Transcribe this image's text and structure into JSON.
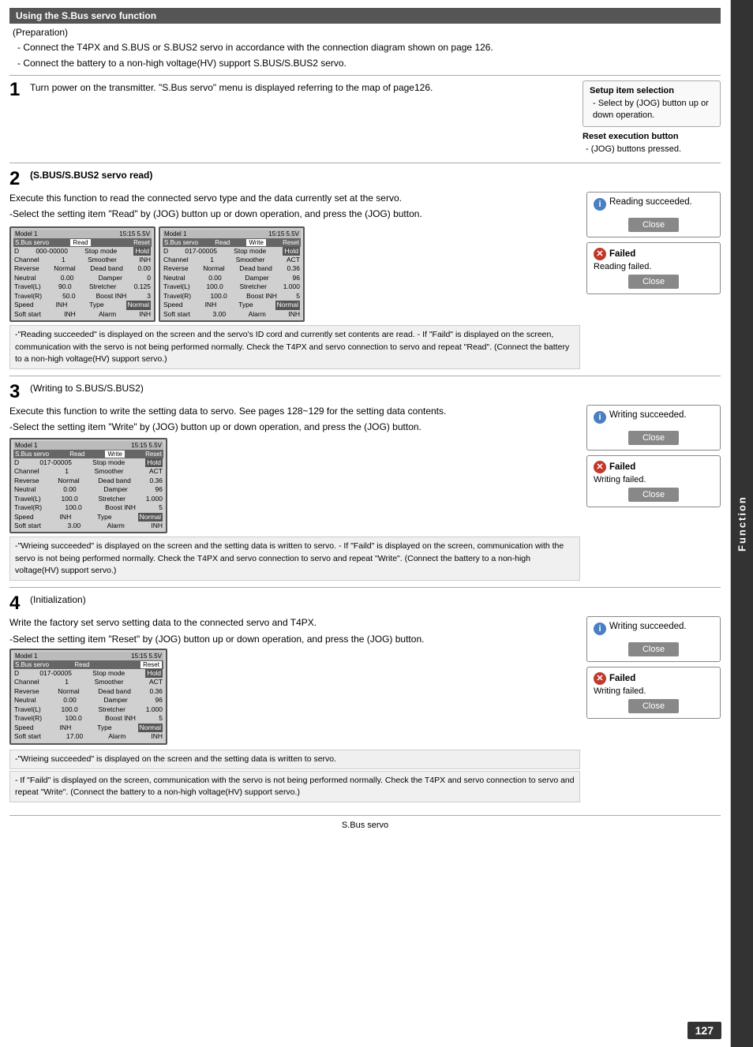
{
  "page": {
    "sidebar_label": "Function",
    "footer_text": "S.Bus servo",
    "page_number": "127"
  },
  "section_title": "Using the S.Bus servo function",
  "preparation": {
    "label": "(Preparation)",
    "bullets": [
      "Connect the T4PX and S.BUS or S.BUS2 servo in accordance with the connection diagram shown on page 126.",
      "Connect the battery to a non-high voltage(HV) support S.BUS/S.BUS2 servo."
    ]
  },
  "step1": {
    "number": "1",
    "body": "Turn power on the transmitter. \"S.Bus servo\" menu is displayed referring to the map of page126.",
    "setup_item": {
      "title": "Setup item selection",
      "text": "- Select by (JOG) button up or down operation."
    },
    "reset_execution": {
      "title": "Reset execution button",
      "text": "- (JOG) buttons pressed."
    }
  },
  "step2": {
    "number": "2",
    "subtitle": "(S.BUS/S.BUS2 servo read)",
    "desc1": "Execute this function to read the connected servo type and the data currently set at the servo.",
    "desc2": "-Select the setting item \"Read\" by (JOG) button up or down operation, and  press the (JOG) button.",
    "screen1": {
      "header": "Model 1        15:15 5.5V",
      "menu": "S.Bus servo   Read          Reset",
      "rows": [
        [
          "D",
          "000-00000",
          "Stop mode",
          "Hold"
        ],
        [
          "Channel",
          "1",
          "Smoother",
          "INH"
        ],
        [
          "Reverse",
          "Normal",
          "Dead band",
          "0.00"
        ],
        [
          "Neutral",
          "0.00",
          "Damper",
          "0"
        ],
        [
          "Travel(L)",
          "90.0",
          "Stretcher",
          "0.125"
        ],
        [
          "Travel(R)",
          "50.0",
          "Boost INH",
          "3"
        ],
        [
          "Speed",
          "INH",
          "Type",
          "Normal"
        ],
        [
          "Soft start",
          "INH",
          "Alarm",
          "INH"
        ]
      ]
    },
    "screen2": {
      "header": "Model 1        15:15 5.5V",
      "menu": "S.Bus servo   Read   Write   Reset",
      "rows": [
        [
          "D",
          "017-00005",
          "Stop mode",
          "Hold"
        ],
        [
          "Channel",
          "1",
          "Smoother",
          "ACT"
        ],
        [
          "Reverse",
          "Normal",
          "Dead band",
          "0.36"
        ],
        [
          "Neutral",
          "0.00",
          "Damper",
          "96"
        ],
        [
          "Travel(L)",
          "100.0",
          "Stretcher",
          "1.000"
        ],
        [
          "Travel(R)",
          "100.0",
          "Boost INH",
          "5"
        ],
        [
          "Speed",
          "INH",
          "Type",
          "Normal"
        ],
        [
          "Soft start",
          "3.00",
          "Alarm",
          "INH"
        ]
      ]
    },
    "reading_succeeded": "Reading succeeded.",
    "close_btn": "Close",
    "failed_label": "Failed",
    "reading_failed": "Reading failed.",
    "note": "-\"Reading succeeded\" is displayed on the screen and the servo's ID cord and currently set contents are read.\n - If \"Faild\" is displayed on the screen, communication with the servo is not being performed normally.\n   Check the T4PX and servo connection to servo and repeat \"Read\". (Connect the battery to a non-high voltage(HV) support servo.)"
  },
  "step3": {
    "number": "3",
    "subtitle": "(Writing to S.BUS/S.BUS2)",
    "desc1": "Execute this function to write the setting data to servo. See pages 128~129 for the setting data contents.",
    "desc2": "-Select the setting item \"Write\" by (JOG) button up or down operation, and  press the (JOG) button.",
    "screen": {
      "header": "Model 1        15:15 5.5V",
      "menu": "S.Bus servo   Read   Write   Reset",
      "rows": [
        [
          "D",
          "017-00005",
          "Stop mode",
          "Hold"
        ],
        [
          "Channel",
          "1",
          "Smoother",
          "ACT"
        ],
        [
          "Reverse",
          "Normal",
          "Dead band",
          "0.36"
        ],
        [
          "Neutral",
          "0.00",
          "Damper",
          "96"
        ],
        [
          "Travel(L)",
          "100.0",
          "Stretcher",
          "1.000"
        ],
        [
          "Travel(R)",
          "100.0",
          "Boost INH",
          "5"
        ],
        [
          "Speed",
          "INH",
          "Type",
          "Normal"
        ],
        [
          "Soft start",
          "3.00",
          "Alarm",
          "INH"
        ]
      ]
    },
    "writing_succeeded": "Writing succeeded.",
    "close_btn": "Close",
    "failed_label": "Failed",
    "writing_failed": "Writing failed.",
    "note": "-\"Wrieing succeeded\" is displayed on the screen and the setting data is written to servo.\n - If \"Faild\" is displayed on the screen, communication with the servo is not being performed normally. Check the T4PX and servo connection to servo and repeat \"Write\". (Connect the battery to a non-high voltage(HV) support servo.)"
  },
  "step4": {
    "number": "4",
    "subtitle": "(Initialization)",
    "desc1": "Write the factory set servo setting data to the connected servo and T4PX.",
    "desc2": "-Select the setting item \"Reset\" by (JOG) button up or down operation, and  press the (JOG) button.",
    "screen": {
      "header": "Model 1        15:15 5.5V",
      "menu": "S.Bus servo   Read          Reset",
      "rows": [
        [
          "D",
          "017-00005",
          "Stop mode",
          "Hold"
        ],
        [
          "Channel",
          "1",
          "Smoother",
          "ACT"
        ],
        [
          "Reverse",
          "Normal",
          "Dead band",
          "0.36"
        ],
        [
          "Neutral",
          "0.00",
          "Damper",
          "96"
        ],
        [
          "Travel(L)",
          "100.0",
          "Stretcher",
          "1.000"
        ],
        [
          "Travel(R)",
          "100.0",
          "Boost INH",
          "5"
        ],
        [
          "Speed",
          "INH",
          "Type",
          "Normal"
        ],
        [
          "Soft start",
          "17.00",
          "Alarm",
          "INH"
        ]
      ]
    },
    "writing_succeeded": "Writing succeeded.",
    "close_btn": "Close",
    "failed_label": "Failed",
    "writing_failed": "Writing failed.",
    "note1": "-\"Wrieing succeeded\" is displayed on the screen and the setting data is written to servo.",
    "note2": "- If \"Faild\" is displayed on the screen, communication with the servo is not being performed normally. Check the T4PX and servo connection to servo and repeat \"Write\".  (Connect the battery to a non-high voltage(HV) support servo.)"
  }
}
